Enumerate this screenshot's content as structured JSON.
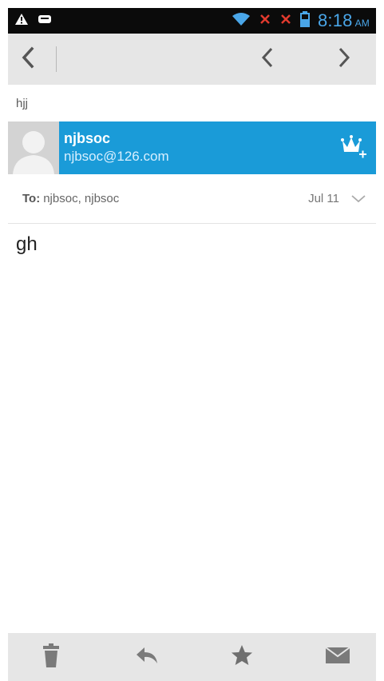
{
  "status_bar": {
    "time": "8:18",
    "ampm": "AM",
    "icons": [
      "warning-icon",
      "notification-icon",
      "wifi-icon",
      "no-signal-icon",
      "no-signal-icon",
      "battery-icon"
    ]
  },
  "toolbar": {
    "back_icon": "back-chevron-icon",
    "prev_icon": "previous-message-icon",
    "next_icon": "next-message-icon"
  },
  "email": {
    "subject": "hjj",
    "sender_name": "njbsoc",
    "sender_email": "njbsoc@126.com",
    "to_label": "To:",
    "to_value": "njbsoc, njbsoc",
    "date": "Jul 11",
    "body": "gh"
  },
  "action_bar": {
    "icons": [
      "trash-icon",
      "reply-icon",
      "star-icon",
      "mark-unread-icon"
    ]
  },
  "colors": {
    "accent_blue": "#1a9bd8",
    "toolbar_gray": "#e6e6e6",
    "status_icon_blue": "#4aa6e8"
  }
}
